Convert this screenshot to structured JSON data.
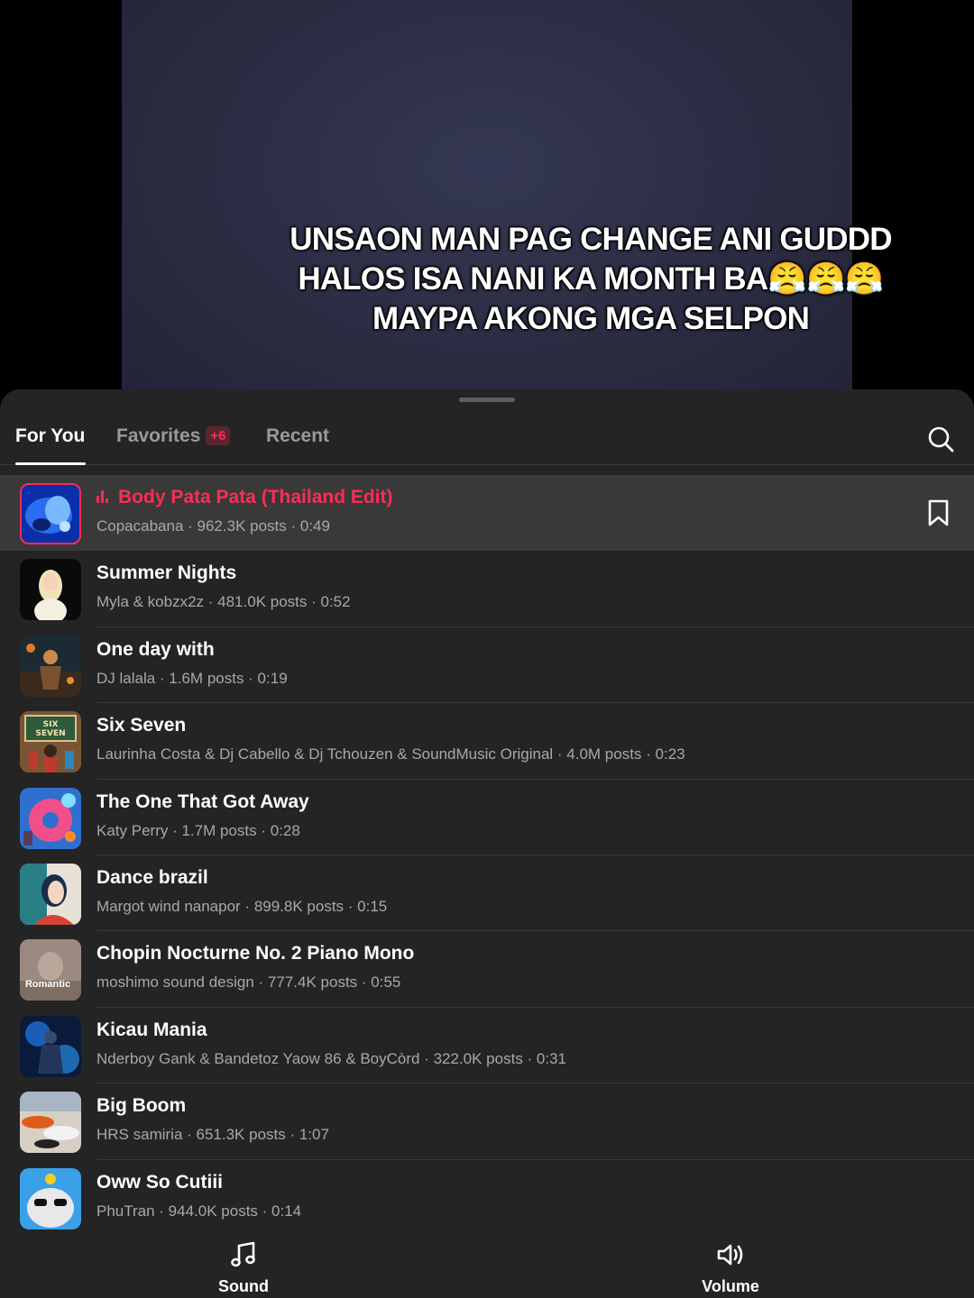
{
  "video": {
    "caption_lines": [
      "UNSAON MAN PAG CHANGE ANI GUDDD",
      "HALOS ISA NANI KA MONTH BA😤😤😤",
      "MAYPA AKONG MGA SELPON"
    ]
  },
  "tabs": {
    "for_you": "For You",
    "favorites": "Favorites",
    "favorites_badge": "+6",
    "recent": "Recent"
  },
  "icons": {
    "search": "search-icon",
    "bookmark": "bookmark-icon",
    "sound": "music-note-icon",
    "volume": "speaker-icon",
    "now_playing": "equalizer-icon"
  },
  "colors": {
    "accent": "#fe2c55",
    "sheet_bg": "#242424",
    "selected_row_bg": "#393939"
  },
  "sounds": [
    {
      "title": "Body Pata Pata (Thailand Edit)",
      "meta": "Copacabana · 962.3K posts · 0:49",
      "selected": true
    },
    {
      "title": "Summer Nights",
      "meta": "Myla & kobzx2z · 481.0K posts · 0:52"
    },
    {
      "title": "One day with",
      "meta": "DJ lalala · 1.6M posts · 0:19"
    },
    {
      "title": "Six Seven",
      "meta": "Laurinha Costa & Dj Cabello & Dj Tchouzen & SoundMusic Original · 4.0M posts · 0:23",
      "thumb_text": "SIX SEVEN"
    },
    {
      "title": "The One That Got Away",
      "meta": "Katy Perry · 1.7M posts · 0:28"
    },
    {
      "title": "Dance brazil",
      "meta": "Margot wind nanapor · 899.8K posts · 0:15"
    },
    {
      "title": "Chopin Nocturne No. 2 Piano Mono",
      "meta": "moshimo sound design · 777.4K posts · 0:55",
      "thumb_text": "Romantic"
    },
    {
      "title": "Kicau Mania",
      "meta": "Nderboy Gank & Bandetoz Yaow 86 & BoyCòrd · 322.0K posts · 0:31"
    },
    {
      "title": "Big Boom",
      "meta": "HRS samiria · 651.3K posts · 1:07"
    },
    {
      "title": "Oww So Cutiii",
      "meta": "PhuTran · 944.0K posts · 0:14"
    }
  ],
  "bottom_bar": {
    "sound_label": "Sound",
    "volume_label": "Volume"
  }
}
